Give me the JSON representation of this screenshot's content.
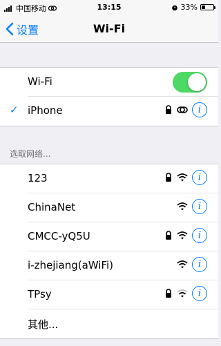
{
  "status_bar": {
    "carrier": "中国移动",
    "time": "13:15",
    "battery": "33%",
    "battery_level": 0.33
  },
  "nav": {
    "back_label": "设置",
    "title": "Wi-Fi"
  },
  "wifi_toggle": {
    "label": "Wi-Fi",
    "on": true
  },
  "connected": {
    "name": "iPhone",
    "check": "✓"
  },
  "section": {
    "header": "选取网络..."
  },
  "networks": [
    {
      "name": "123",
      "secured": true
    },
    {
      "name": "ChinaNet",
      "secured": false
    },
    {
      "name": "CMCC-yQ5U",
      "secured": true
    },
    {
      "name": "i-zhejiang(aWiFi)",
      "secured": false
    },
    {
      "name": "TPsy",
      "secured": true
    }
  ],
  "other": {
    "label": "其他..."
  },
  "info_symbol": "i",
  "colors": {
    "accent": "#007aff",
    "toggle_on": "#4cd964",
    "background": "#efeff4"
  }
}
